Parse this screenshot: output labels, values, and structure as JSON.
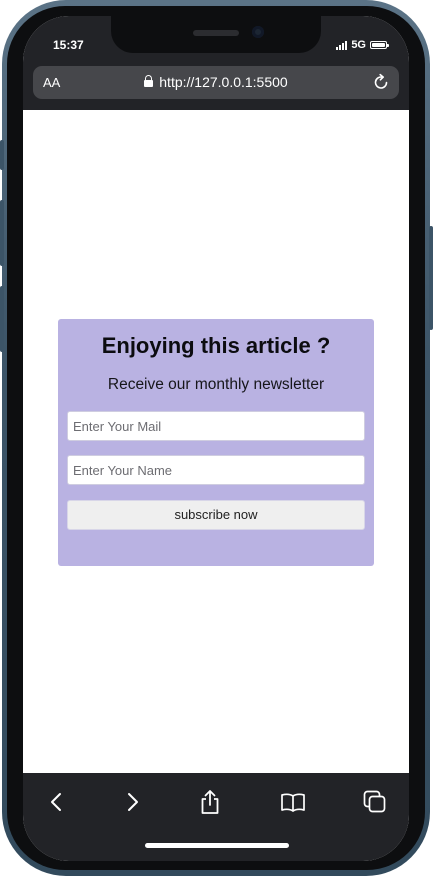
{
  "status_bar": {
    "time": "15:37",
    "network": "5G"
  },
  "browser": {
    "text_size_label": "AA",
    "url": "http://127.0.0.1:5500"
  },
  "newsletter": {
    "title": "Enjoying this article ?",
    "subtitle": "Receive our monthly newsletter",
    "email_placeholder": "Enter Your Mail",
    "name_placeholder": "Enter Your Name",
    "button_label": "subscribe now",
    "card_color": "#b9b2e2"
  },
  "toolbar": {
    "icons": [
      "back-icon",
      "forward-icon",
      "share-icon",
      "bookmarks-icon",
      "tabs-icon"
    ]
  }
}
